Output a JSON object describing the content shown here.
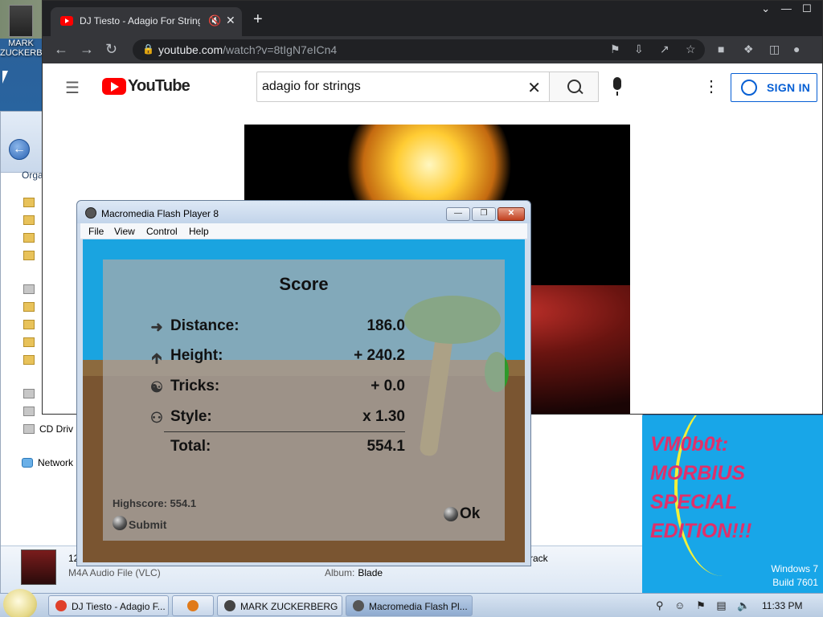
{
  "desktop": {
    "icon_label": "MARK ZUCKERB",
    "banner_text": [
      "VM0b0t:",
      "MORBIUS",
      "SPECIAL",
      "EDITION!!!"
    ],
    "os_version": [
      "Windows 7",
      "Build 7601"
    ]
  },
  "explorer": {
    "organize": "Orga",
    "tree": {
      "cd_drive": "CD Driv",
      "network": "Network"
    },
    "details": {
      "name_fragment": "12",
      "type": "M4A Audio File (VLC)",
      "album_label": "Album:",
      "album_value": "Blade",
      "extra": "ltrack"
    }
  },
  "chrome": {
    "tab_title": "DJ Tiesto - Adagio For Strings",
    "url_host": "youtube.com",
    "url_path": "/watch?v=8tIgN7eICn4"
  },
  "youtube": {
    "logo_text": "YouTube",
    "search_value": "adagio for strings",
    "sign_in": "SIGN IN"
  },
  "flash": {
    "window_title": "Macromedia Flash Player 8",
    "menu": [
      "File",
      "View",
      "Control",
      "Help"
    ],
    "score_title": "Score",
    "rows": [
      {
        "icon": "arrow-right-icon",
        "label": "Distance:",
        "value": "186.0"
      },
      {
        "icon": "arrow-up-icon",
        "label": "Height:",
        "value": "+ 240.2"
      },
      {
        "icon": "tricks-icon",
        "label": "Tricks:",
        "value": "+ 0.0"
      },
      {
        "icon": "style-icon",
        "label": "Style:",
        "value": "x 1.30"
      },
      {
        "icon": "",
        "label": "Total:",
        "value": "554.1"
      }
    ],
    "highscore": "Highscore: 554.1",
    "submit": "Submit",
    "ok": "Ok"
  },
  "taskbar": {
    "items": [
      {
        "label": "DJ Tiesto - Adagio F...",
        "color": "#e0402a"
      },
      {
        "label": "",
        "color": "#e07a1a"
      },
      {
        "label": "MARK ZUCKERBERG",
        "color": "#444444"
      },
      {
        "label": "Macromedia Flash Pl...",
        "color": "#555555"
      }
    ],
    "clock": "11:33 PM"
  }
}
